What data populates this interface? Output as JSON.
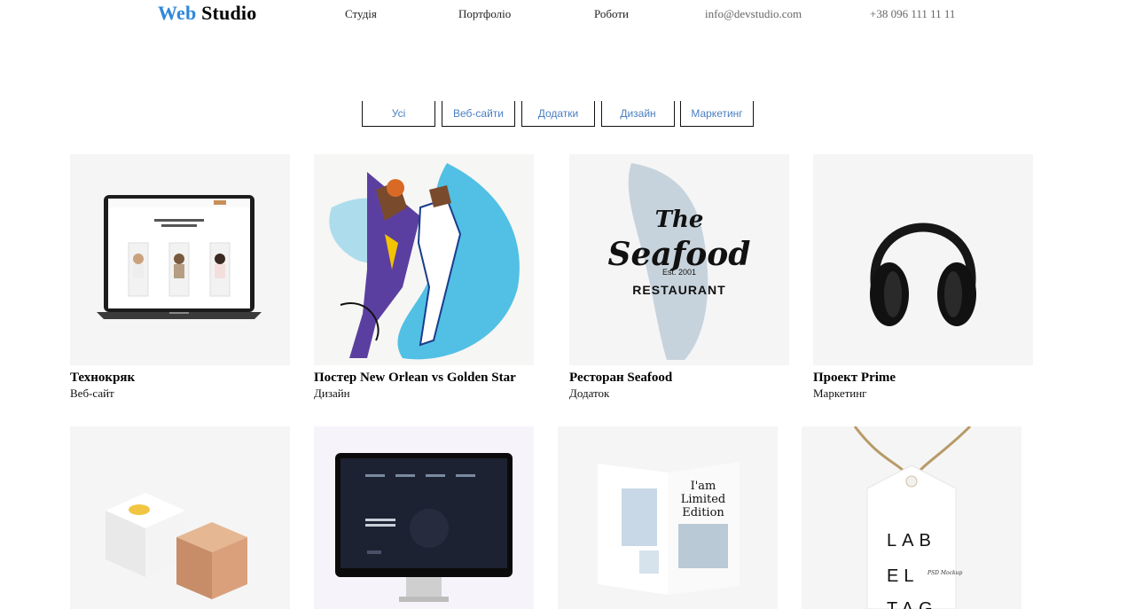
{
  "header": {
    "logo_part1": "Web",
    "logo_part2": "Studio",
    "nav": {
      "studio": "Студія",
      "portfolio": "Портфоліо",
      "works": "Роботи"
    },
    "email": "info@devstudio.com",
    "phone": "+38 096 111 11 11"
  },
  "filters": {
    "all": "Усі",
    "websites": "Веб-сайти",
    "apps": "Додатки",
    "design": "Дизайн",
    "marketing": "Маркетинг"
  },
  "projects": [
    {
      "title": "Технокряк",
      "category": "Веб-сайт",
      "image": "laptop-website-mockup"
    },
    {
      "title": "Постер New Orlean vs Golden Star",
      "category": "Дизайн",
      "image": "basketball-poster"
    },
    {
      "title": "Ресторан Seafood",
      "category": "Додаток",
      "image": "seafood-logo"
    },
    {
      "title": "Проект Prime",
      "category": "Маркетинг",
      "image": "headphones"
    },
    {
      "image": "boxes-mockup"
    },
    {
      "image": "monitor-mockup"
    },
    {
      "image": "magazine-mockup"
    },
    {
      "image": "label-tag-mockup"
    }
  ],
  "images": {
    "seafood_line1": "The",
    "seafood_line2": "Seafood",
    "seafood_est": "Est. 2001",
    "seafood_line3": "RESTAURANT",
    "magazine_line1": "I'am",
    "magazine_line2": "Limited",
    "magazine_line3": "Edition",
    "tag_line1": "LAB",
    "tag_line2": "EL",
    "tag_line3": "TAG",
    "tag_small": "PSD Mockup"
  },
  "colors": {
    "brand_blue": "#2f87d9",
    "filter_text": "#4a7fc1",
    "thumb_bg": "#f5f5f5"
  }
}
